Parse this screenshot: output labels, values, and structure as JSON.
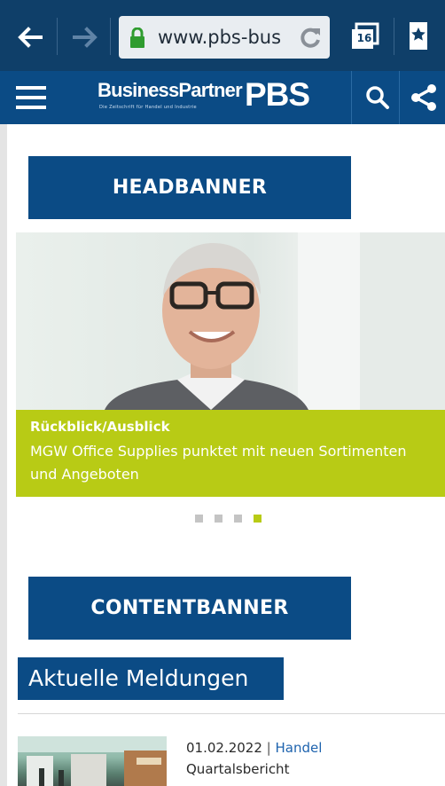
{
  "browser": {
    "url": "www.pbs-bus",
    "tab_count": "16"
  },
  "site": {
    "logo_brand": "BusinessPartner",
    "logo_sub": "Die Zeitschrift für Handel und Industrie",
    "logo_mark": "PBS"
  },
  "banners": {
    "head": "HEADBANNER",
    "content": "CONTENTBANNER"
  },
  "slider": {
    "category": "Rückblick/Ausblick",
    "title": "MGW Office Supplies punktet mit neuen Sortimenten und Angeboten",
    "total_slides": 4,
    "active_slide": 4
  },
  "news": {
    "section_title": "Aktuelle Meldungen",
    "items": [
      {
        "date": "01.02.2022",
        "separator": "|",
        "category": "Handel",
        "title": "Quartalsbericht"
      }
    ]
  },
  "colors": {
    "toolbar": "#0f3f69",
    "brand_blue": "#0b4b85",
    "accent_lime": "#b8cb15",
    "link_blue": "#1e63ae"
  }
}
